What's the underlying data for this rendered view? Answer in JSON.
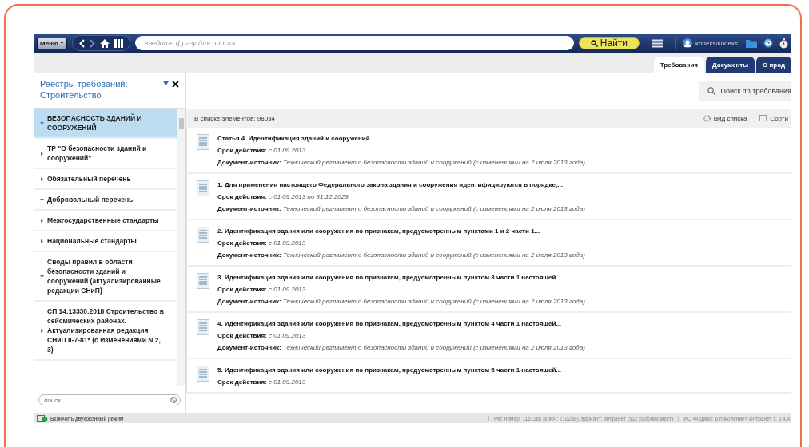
{
  "toolbar": {
    "menu": "Меню",
    "search": {
      "placeholder": "введите фразу для поиска"
    },
    "find": "Найти",
    "user": "kodeks/kodeks"
  },
  "tabs": [
    {
      "label": "Требования",
      "selected": true
    },
    {
      "label": "Документы",
      "selected": false
    },
    {
      "label": "О прод",
      "selected": false
    }
  ],
  "sidebar": {
    "title": "Реестры требований: Строительство",
    "search": {
      "placeholder": "поиск"
    },
    "tree": [
      {
        "label": "БЕЗОПАСНОСТЬ ЗДАНИЙ И СООРУЖЕНИЙ",
        "expanded": true,
        "selected": true,
        "children": [
          {
            "label": "ТР \"О безопасности зданий и сооружений\"",
            "expanded": false,
            "selected": false
          },
          {
            "label": "Обязательный перечень",
            "expanded": false,
            "selected": false
          },
          {
            "label": "Добровольный перечень",
            "expanded": true,
            "selected": false,
            "children": [
              {
                "label": "Межгосударственные стандарты",
                "expanded": false,
                "selected": false
              },
              {
                "label": "Национальные стандарты",
                "expanded": false,
                "selected": false
              },
              {
                "label": "Своды правил в области безопасности зданий и сооружений (актуализированные редакции СНиП)",
                "expanded": true,
                "selected": false,
                "children": [
                  {
                    "label": "СП 14.13330.2018 Строительство в сейсмических районах. Актуализированная редакция СНиП II-7-81* (с Изменениями N 2, 3)",
                    "expanded": false,
                    "selected": false
                  }
                ]
              }
            ]
          }
        ]
      }
    ]
  },
  "main": {
    "search_button": "Поиск по требования",
    "count": "В списке элементов: 98034",
    "view": "Вид списка",
    "sort": "Сорти",
    "items": [
      {
        "title": "Статья 4. Идентификация зданий и сооружений",
        "fields": [
          {
            "label": "Срок действия:",
            "value": "с 01.09.2013"
          },
          {
            "label": "Документ-источник:",
            "value": "Технический регламент о безопасности зданий и сооружений (с изменениями на 2 июля 2013 года)"
          }
        ]
      },
      {
        "title": "1. Для применения настоящего Федерального закона здания и сооружения идентифицируются в порядке,...",
        "fields": [
          {
            "label": "Срок действия:",
            "value": "с 01.09.2013 по 31.12.2029"
          },
          {
            "label": "Документ-источник:",
            "value": "Технический регламент о безопасности зданий и сооружений (с изменениями на 2 июля 2013 года)"
          }
        ]
      },
      {
        "title": "2. Идентификация здания или сооружения по признакам, предусмотренным пунктами 1 и 2 части 1...",
        "fields": [
          {
            "label": "Срок действия:",
            "value": "с 01.09.2013"
          },
          {
            "label": "Документ-источник:",
            "value": "Технический регламент о безопасности зданий и сооружений (с изменениями на 2 июля 2013 года)"
          }
        ]
      },
      {
        "title": "3. Идентификация здания или сооружения по признакам, предусмотренным пунктом 3 части 1 настоящей...",
        "fields": [
          {
            "label": "Срок действия:",
            "value": "с 01.09.2013"
          },
          {
            "label": "Документ-источник:",
            "value": "Технический регламент о безопасности зданий и сооружений (с изменениями на 2 июля 2013 года)"
          }
        ]
      },
      {
        "title": "4. Идентификация здания или сооружения по признакам, предусмотренным пунктом 4 части 1 настоящей...",
        "fields": [
          {
            "label": "Срок действия:",
            "value": "с 01.09.2013"
          },
          {
            "label": "Документ-источник:",
            "value": "Технический регламент о безопасности зданий и сооружений (с изменениями на 2 июля 2013 года)"
          }
        ]
      },
      {
        "title": "5. Идентификация здания или сооружения по признакам, предусмотренным пунктом 5 части 1 настоящей...",
        "fields": [
          {
            "label": "Срок действия:",
            "value": "с 01.09.2013"
          }
        ]
      }
    ]
  },
  "status_bar": {
    "dual_mode": "Включить двухоконный режим",
    "registration": "Рег. номер: 116116s (ключ: 210288), вариант: интранет (512 рабочих мест)",
    "version": "ИС «Кодекс: 6 поколение» Интранет v. 6.4.4."
  }
}
